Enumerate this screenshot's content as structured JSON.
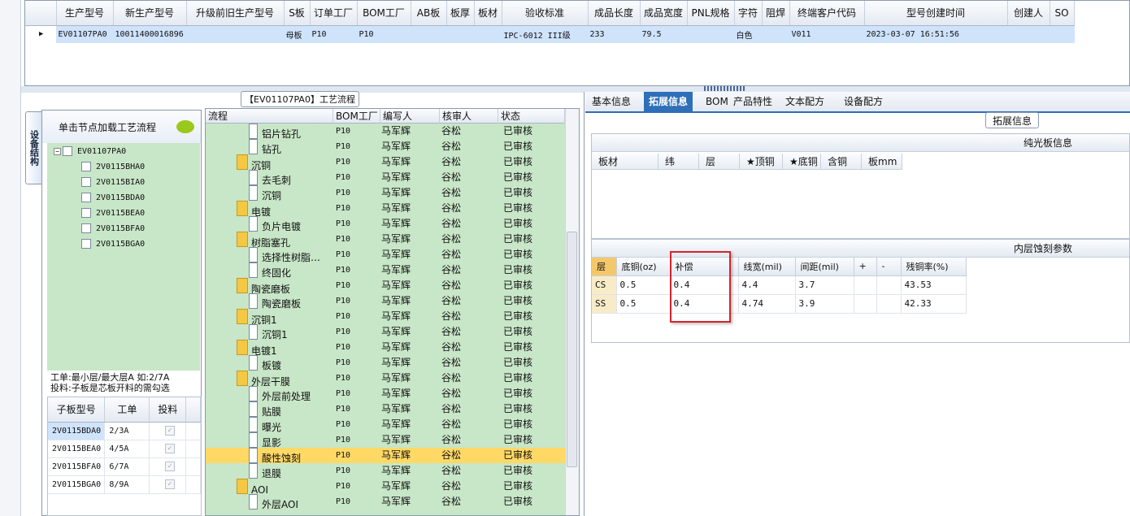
{
  "top_grid": {
    "columns": [
      "生产型号",
      "新生产型号",
      "升级前旧生产型号",
      "S板",
      "订单工厂",
      "BOM工厂",
      "AB板",
      "板厚",
      "板材",
      "验收标准",
      "成品长度",
      "成品宽度",
      "PNL规格",
      "字符",
      "阻焊",
      "终端客户代码",
      "型号创建时间",
      "创建人",
      "SO"
    ],
    "row": [
      "EV01107PA0",
      "10011400016896",
      "",
      "母板",
      "P10",
      "P10",
      "",
      "",
      "",
      "IPC-6012 III级",
      "233",
      "79.5",
      "",
      "白色",
      "",
      "V011",
      "2023-03-07 16:51:56",
      "",
      ""
    ],
    "row_indicator": "▶"
  },
  "side_tab": "设备结构",
  "left": {
    "header": "单击节点加载工艺流程",
    "tree_root": "EV01107PA0",
    "tree_children": [
      "2V0115BHA0",
      "2V0115BIA0",
      "2V0115BDA0",
      "2V0115BEA0",
      "2V0115BFA0",
      "2V0115BGA0"
    ],
    "note1": "工单:最小层/最大层A 如:2/7A",
    "note2": "投料:子板是芯板开料的需勾选",
    "sub_columns": [
      "子板型号",
      "工单",
      "投料"
    ],
    "sub_rows": [
      [
        "2V0115BDA0",
        "2/3A"
      ],
      [
        "2V0115BEA0",
        "4/5A"
      ],
      [
        "2V0115BFA0",
        "6/7A"
      ],
      [
        "2V0115BGA0",
        "8/9A"
      ]
    ],
    "check_mark": "✓"
  },
  "mid": {
    "title": "【EV01107PA0】工艺流程",
    "columns": [
      "流程",
      "BOM工厂",
      "编写人",
      "核审人",
      "状态"
    ],
    "rows": [
      {
        "name": "铝片钻孔",
        "type": "file",
        "factory": "P10",
        "writer": "马军辉",
        "reviewer": "谷松",
        "status": "已审核"
      },
      {
        "name": "钻孔",
        "type": "file",
        "factory": "P10",
        "writer": "马军辉",
        "reviewer": "谷松",
        "status": "已审核"
      },
      {
        "name": "沉铜",
        "type": "folder",
        "factory": "P10",
        "writer": "马军辉",
        "reviewer": "谷松",
        "status": "已审核"
      },
      {
        "name": "去毛刺",
        "type": "file",
        "factory": "P10",
        "writer": "马军辉",
        "reviewer": "谷松",
        "status": "已审核"
      },
      {
        "name": "沉铜",
        "type": "file",
        "factory": "P10",
        "writer": "马军辉",
        "reviewer": "谷松",
        "status": "已审核"
      },
      {
        "name": "电镀",
        "type": "folder",
        "factory": "P10",
        "writer": "马军辉",
        "reviewer": "谷松",
        "status": "已审核"
      },
      {
        "name": "负片电镀",
        "type": "file",
        "factory": "P10",
        "writer": "马军辉",
        "reviewer": "谷松",
        "status": "已审核"
      },
      {
        "name": "树脂塞孔",
        "type": "folder",
        "factory": "P10",
        "writer": "马军辉",
        "reviewer": "谷松",
        "status": "已审核"
      },
      {
        "name": "选择性树脂…",
        "type": "file",
        "factory": "P10",
        "writer": "马军辉",
        "reviewer": "谷松",
        "status": "已审核"
      },
      {
        "name": "终固化",
        "type": "file",
        "factory": "P10",
        "writer": "马军辉",
        "reviewer": "谷松",
        "status": "已审核"
      },
      {
        "name": "陶瓷磨板",
        "type": "folder",
        "factory": "P10",
        "writer": "马军辉",
        "reviewer": "谷松",
        "status": "已审核"
      },
      {
        "name": "陶瓷磨板",
        "type": "file",
        "factory": "P10",
        "writer": "马军辉",
        "reviewer": "谷松",
        "status": "已审核"
      },
      {
        "name": "沉铜1",
        "type": "folder",
        "factory": "P10",
        "writer": "马军辉",
        "reviewer": "谷松",
        "status": "已审核"
      },
      {
        "name": "沉铜1",
        "type": "file",
        "factory": "P10",
        "writer": "马军辉",
        "reviewer": "谷松",
        "status": "已审核"
      },
      {
        "name": "电镀1",
        "type": "folder",
        "factory": "P10",
        "writer": "马军辉",
        "reviewer": "谷松",
        "status": "已审核"
      },
      {
        "name": "板镀",
        "type": "file",
        "factory": "P10",
        "writer": "马军辉",
        "reviewer": "谷松",
        "status": "已审核"
      },
      {
        "name": "外层干膜",
        "type": "folder",
        "factory": "P10",
        "writer": "马军辉",
        "reviewer": "谷松",
        "status": "已审核"
      },
      {
        "name": "外层前处理",
        "type": "file",
        "factory": "P10",
        "writer": "马军辉",
        "reviewer": "谷松",
        "status": "已审核"
      },
      {
        "name": "贴膜",
        "type": "file",
        "factory": "P10",
        "writer": "马军辉",
        "reviewer": "谷松",
        "status": "已审核"
      },
      {
        "name": "曝光",
        "type": "file",
        "factory": "P10",
        "writer": "马军辉",
        "reviewer": "谷松",
        "status": "已审核"
      },
      {
        "name": "显影",
        "type": "file",
        "factory": "P10",
        "writer": "马军辉",
        "reviewer": "谷松",
        "status": "已审核"
      },
      {
        "name": "酸性蚀刻",
        "type": "file",
        "factory": "P10",
        "writer": "马军辉",
        "reviewer": "谷松",
        "status": "已审核",
        "highlight": true
      },
      {
        "name": "退膜",
        "type": "file",
        "factory": "P10",
        "writer": "马军辉",
        "reviewer": "谷松",
        "status": "已审核"
      },
      {
        "name": "AOI",
        "type": "folder",
        "factory": "P10",
        "writer": "马军辉",
        "reviewer": "谷松",
        "status": "已审核"
      },
      {
        "name": "外层AOI",
        "type": "file",
        "factory": "P10",
        "writer": "马军辉",
        "reviewer": "谷松",
        "status": "已审核"
      }
    ]
  },
  "right": {
    "tabs": [
      "基本信息",
      "拓展信息",
      "BOM",
      "产品特性",
      "文本配方",
      "设备配方"
    ],
    "active_tab": 1,
    "ext_title": "拓展信息",
    "plain_title": "纯光板信息",
    "plain_columns": [
      "板材",
      "纬",
      "层",
      "★顶铜",
      "★底铜",
      "含铜",
      "板mm"
    ],
    "inner_title": "内层蚀刻参数",
    "inner_columns": [
      "层",
      "底铜(oz)",
      "补偿",
      "线宽(mil)",
      "间距(mil)",
      "+",
      "-",
      "残铜率(%)"
    ],
    "inner_rows": [
      [
        "CS",
        "0.5",
        "0.4",
        "4.4",
        "3.7",
        "",
        "",
        "43.53"
      ],
      [
        "SS",
        "0.5",
        "0.4",
        "4.74",
        "3.9",
        "",
        "",
        "42.33"
      ]
    ]
  },
  "colors": {
    "accent": "#2e6fb8",
    "selection": "#cfe3fb",
    "tree_bg": "#c8e6c8",
    "highlight": "#ffd966",
    "annotation": "#d8232a"
  }
}
